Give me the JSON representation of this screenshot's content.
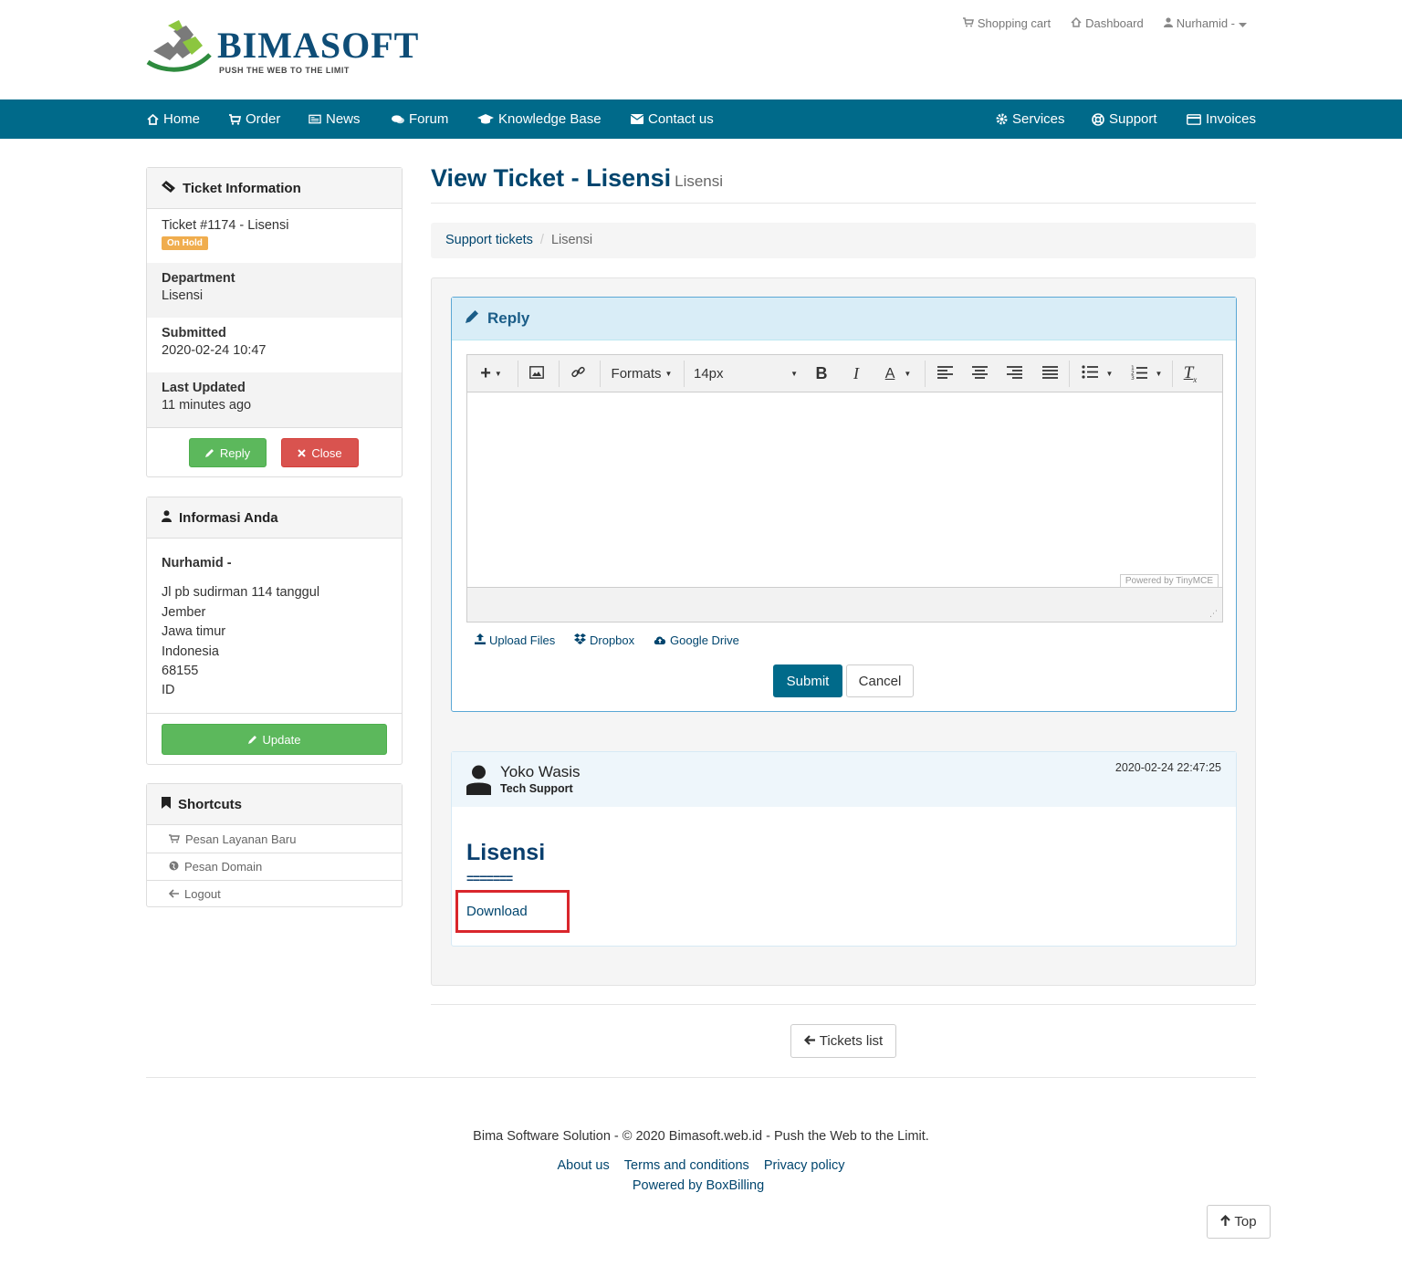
{
  "brand": {
    "name": "BIMASOFT",
    "tagline": "PUSH THE WEB TO THE LIMIT"
  },
  "top_links": {
    "cart": "Shopping cart",
    "dashboard": "Dashboard",
    "user": "Nurhamid -"
  },
  "nav": {
    "home": "Home",
    "order": "Order",
    "news": "News",
    "forum": "Forum",
    "kb": "Knowledge Base",
    "contact": "Contact us",
    "services": "Services",
    "support": "Support",
    "invoices": "Invoices"
  },
  "ticket_info": {
    "title": "Ticket Information",
    "ticket": "Ticket #1174 - Lisensi",
    "status": "On Hold",
    "department_label": "Department",
    "department": "Lisensi",
    "submitted_label": "Submitted",
    "submitted": "2020-02-24 10:47",
    "updated_label": "Last Updated",
    "updated": "11 minutes ago",
    "reply_btn": "Reply",
    "close_btn": "Close"
  },
  "your_info": {
    "title": "Informasi Anda",
    "name": "Nurhamid -",
    "address": [
      "Jl pb sudirman 114 tanggul",
      "Jember",
      "Jawa timur",
      "Indonesia",
      "68155",
      "ID"
    ],
    "update_btn": "Update"
  },
  "shortcuts": {
    "title": "Shortcuts",
    "items": [
      "Pesan Layanan Baru",
      "Pesan Domain",
      "Logout"
    ]
  },
  "page": {
    "title": "View Ticket - Lisensi",
    "subtitle": "Lisensi"
  },
  "breadcrumb": {
    "parent": "Support tickets",
    "current": "Lisensi"
  },
  "reply": {
    "title": "Reply",
    "formats": "Formats",
    "font_size": "14px",
    "powered": "Powered by TinyMCE",
    "upload": "Upload Files",
    "dropbox": "Dropbox",
    "gdrive": "Google Drive",
    "submit": "Submit",
    "cancel": "Cancel"
  },
  "message": {
    "author": "Yoko Wasis",
    "role": "Tech Support",
    "date": "2020-02-24 22:47:25",
    "heading": "Lisensi",
    "underline": "=======",
    "link": "Download"
  },
  "tickets_list_btn": "Tickets list",
  "footer": {
    "copyright": "Bima Software Solution - © 2020 Bimasoft.web.id - Push the Web to the Limit.",
    "about": "About us",
    "terms": "Terms and conditions",
    "privacy": "Privacy policy",
    "powered": "Powered by BoxBilling"
  },
  "top_btn": "Top",
  "colors": {
    "nav": "#006a8a",
    "brand": "#00456e",
    "success": "#5cb85c",
    "danger": "#d9534f",
    "warning": "#f0ad4e"
  }
}
